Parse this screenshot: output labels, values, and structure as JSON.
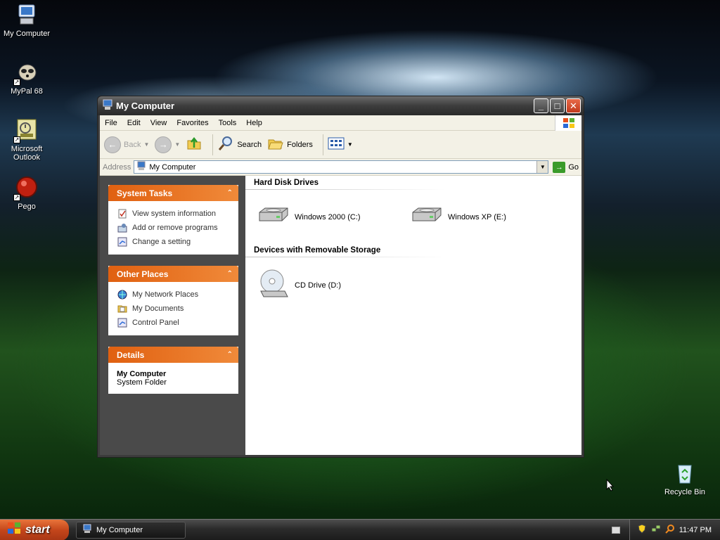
{
  "desktop": {
    "icons": [
      {
        "label": "My Computer"
      },
      {
        "label": "MyPal 68"
      },
      {
        "label": "Microsoft Outlook"
      },
      {
        "label": "Pego"
      },
      {
        "label": "Recycle Bin"
      }
    ]
  },
  "window": {
    "title": "My Computer",
    "menu": [
      "File",
      "Edit",
      "View",
      "Favorites",
      "Tools",
      "Help"
    ],
    "toolbar": {
      "back": "Back",
      "search": "Search",
      "folders": "Folders"
    },
    "address": {
      "label": "Address",
      "value": "My Computer",
      "go": "Go"
    },
    "taskpane": {
      "system_tasks": {
        "title": "System Tasks",
        "items": [
          "View system information",
          "Add or remove programs",
          "Change a setting"
        ]
      },
      "other_places": {
        "title": "Other Places",
        "items": [
          "My Network Places",
          "My Documents",
          "Control Panel"
        ]
      },
      "details": {
        "title": "Details",
        "name": "My Computer",
        "type": "System Folder"
      }
    },
    "groups": {
      "hard_disks": {
        "title": "Hard Disk Drives",
        "items": [
          "Windows 2000 (C:)",
          "Windows XP (E:)"
        ]
      },
      "removable": {
        "title": "Devices with Removable Storage",
        "items": [
          "CD Drive (D:)"
        ]
      }
    }
  },
  "taskbar": {
    "start": "start",
    "task_button": "My Computer",
    "clock": "11:47 PM"
  }
}
